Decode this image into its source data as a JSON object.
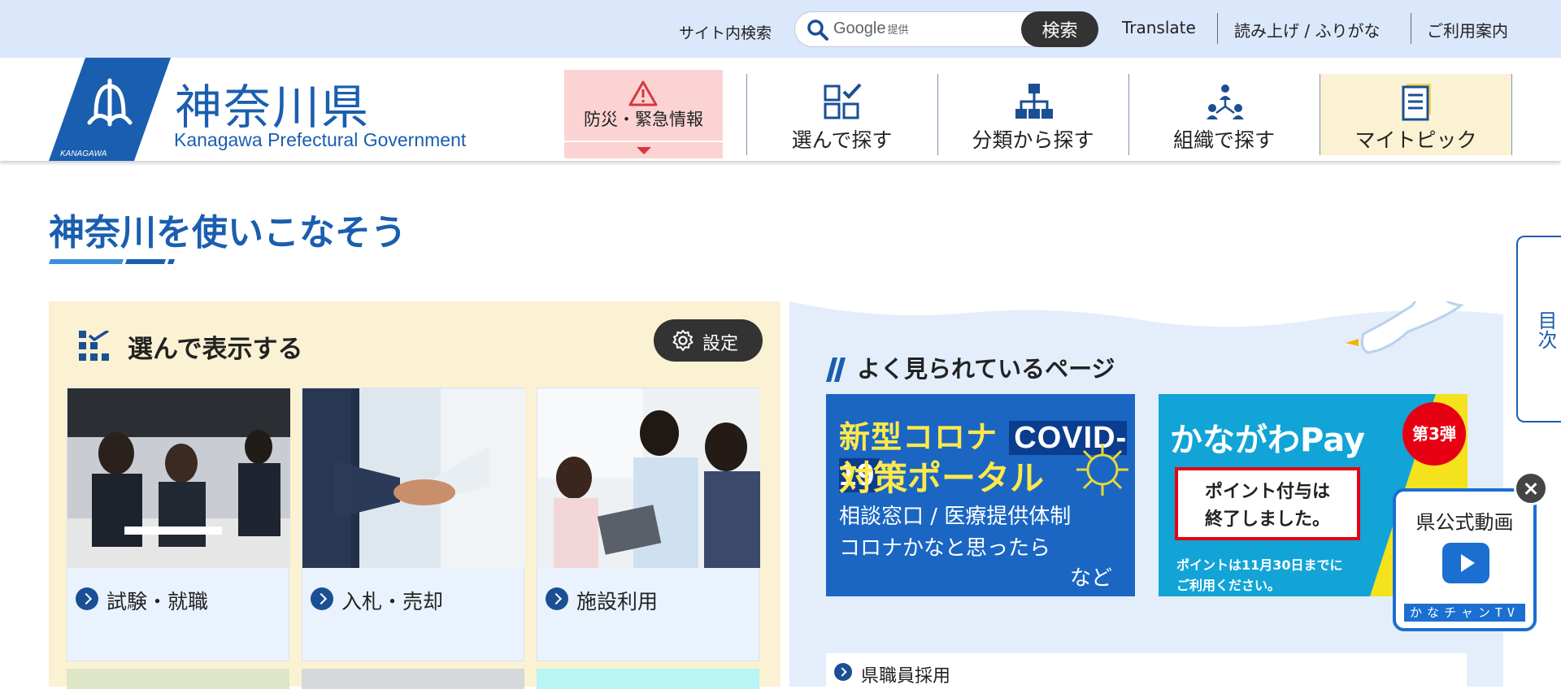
{
  "topbar": {
    "search_label": "サイト内検索",
    "search_placeholder_brand": "Google",
    "search_placeholder_suffix": "提供",
    "search_button": "検索",
    "links": [
      "Translate",
      "読み上げ / ふりがな",
      "ご利用案内"
    ]
  },
  "header": {
    "logo_title": "神奈川県",
    "logo_sub": "Kanagawa Prefectural Government",
    "logo_mark_text": "KANAGAWA",
    "emergency_label": "防災・緊急情報",
    "nav": [
      {
        "label": "選んで探す",
        "icon": "checklist-icon"
      },
      {
        "label": "分類から探す",
        "icon": "hierarchy-icon"
      },
      {
        "label": "組織で探す",
        "icon": "organization-icon"
      },
      {
        "label": "マイトピック",
        "icon": "document-icon"
      }
    ]
  },
  "main": {
    "section_title": "神奈川を使いこなそう"
  },
  "left_panel": {
    "title": "選んで表示する",
    "settings_label": "設定",
    "cards": [
      {
        "label": "試験・就職"
      },
      {
        "label": "入札・売却"
      },
      {
        "label": "施設利用"
      }
    ]
  },
  "right_panel": {
    "popular_title": "よく見られているページ",
    "covid_banner": {
      "line1": "新型コロナ",
      "line1_tag": "COVID-19",
      "line2": "対策ポータル",
      "line3": "相談窓口 / 医療提供体制",
      "line4": "コロナかなと思ったら",
      "line5": "など"
    },
    "kpay_banner": {
      "title": "かながわPay",
      "badge": "第3弾",
      "notice_line1": "ポイント付与は",
      "notice_line2": "終了しました。",
      "foot1": "ポイントは11月30日までに",
      "foot2": "ご利用ください。"
    },
    "list_items": [
      "県職員採用"
    ]
  },
  "side": {
    "toc_label": "目次",
    "video_title": "県公式動画",
    "video_strip": "かなチャンTV"
  },
  "colors": {
    "brand_blue": "#1a5eaf",
    "topbar_bg": "#dbe7fb",
    "emergency_bg": "#fbd3d3",
    "mytopic_bg": "#fbf1d3",
    "panel_yellow": "#fbf1d3",
    "panel_blue": "#e4eefb"
  }
}
